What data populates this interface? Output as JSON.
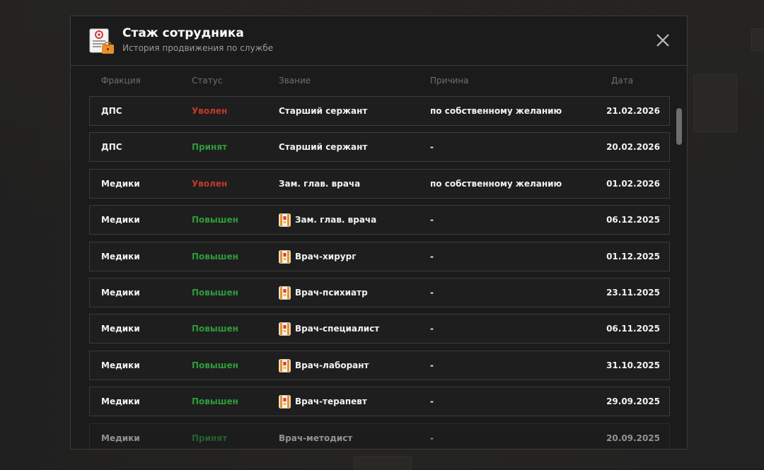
{
  "header": {
    "title": "Стаж сотрудника",
    "subtitle": "История продвижения по службе",
    "icon": "document-briefcase-icon",
    "close_icon": "close-icon"
  },
  "columns": {
    "faction": "Фракция",
    "status": "Статус",
    "rank": "Звание",
    "reason": "Причина",
    "date": "Дата"
  },
  "colors": {
    "fired": "#c0392b",
    "hired": "#2e9b3a",
    "promoted": "#2e9b3a"
  },
  "rows": [
    {
      "faction": "ДПС",
      "status": "Уволен",
      "status_type": "fired",
      "rank": "Старший сержант",
      "rank_icon": "",
      "reason": "по собственному желанию",
      "date": "21.02.2026"
    },
    {
      "faction": "ДПС",
      "status": "Принят",
      "status_type": "hired",
      "rank": "Старший сержант",
      "rank_icon": "",
      "reason": "-",
      "date": "20.02.2026"
    },
    {
      "faction": "Медики",
      "status": "Уволен",
      "status_type": "fired",
      "rank": "Зам. глав. врача",
      "rank_icon": "",
      "reason": "по собственному желанию",
      "date": "01.02.2026"
    },
    {
      "faction": "Медики",
      "status": "Повышен",
      "status_type": "promoted",
      "rank": "Зам. глав. врача",
      "rank_icon": "epaulette-icon",
      "reason": "-",
      "date": "06.12.2025"
    },
    {
      "faction": "Медики",
      "status": "Повышен",
      "status_type": "promoted",
      "rank": "Врач-хирург",
      "rank_icon": "epaulette-icon",
      "reason": "-",
      "date": "01.12.2025"
    },
    {
      "faction": "Медики",
      "status": "Повышен",
      "status_type": "promoted",
      "rank": "Врач-психиатр",
      "rank_icon": "epaulette-icon",
      "reason": "-",
      "date": "23.11.2025"
    },
    {
      "faction": "Медики",
      "status": "Повышен",
      "status_type": "promoted",
      "rank": "Врач-специалист",
      "rank_icon": "epaulette-icon",
      "reason": "-",
      "date": "06.11.2025"
    },
    {
      "faction": "Медики",
      "status": "Повышен",
      "status_type": "promoted",
      "rank": "Врач-лаборант",
      "rank_icon": "epaulette-icon",
      "reason": "-",
      "date": "31.10.2025"
    },
    {
      "faction": "Медики",
      "status": "Повышен",
      "status_type": "promoted",
      "rank": "Врач-терапевт",
      "rank_icon": "epaulette-icon",
      "reason": "-",
      "date": "29.09.2025"
    },
    {
      "faction": "Медики",
      "status": "Принят",
      "status_type": "hired",
      "rank": "Врач-методист",
      "rank_icon": "",
      "reason": "-",
      "date": "20.09.2025"
    }
  ]
}
